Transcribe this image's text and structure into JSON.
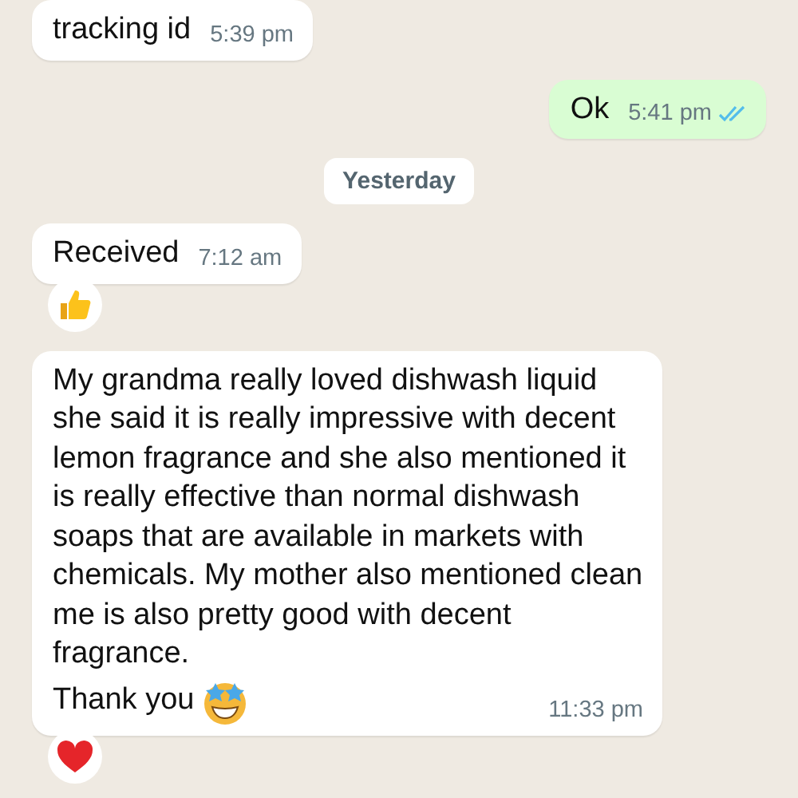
{
  "messages": [
    {
      "kind": "incoming",
      "text": "tracking id",
      "time": "5:39 pm"
    },
    {
      "kind": "outgoing",
      "text": "Ok",
      "time": "5:41 pm",
      "read": true
    },
    {
      "kind": "date",
      "text": "Yesterday"
    },
    {
      "kind": "incoming",
      "text": "Received",
      "time": "7:12 am",
      "reaction": {
        "kind": "thumbs"
      }
    },
    {
      "kind": "incoming",
      "text": "My grandma really loved dishwash liquid she said it is really impressive with decent lemon fragrance and she also mentioned it is really effective than normal dishwash soaps that are available in markets with chemicals. My mother also mentioned clean me is also pretty good with decent fragrance.",
      "text_2": "Thank you",
      "emoji": {
        "kind": "star-eyes"
      },
      "time": "11:33 pm",
      "reaction": {
        "kind": "heart"
      }
    }
  ]
}
